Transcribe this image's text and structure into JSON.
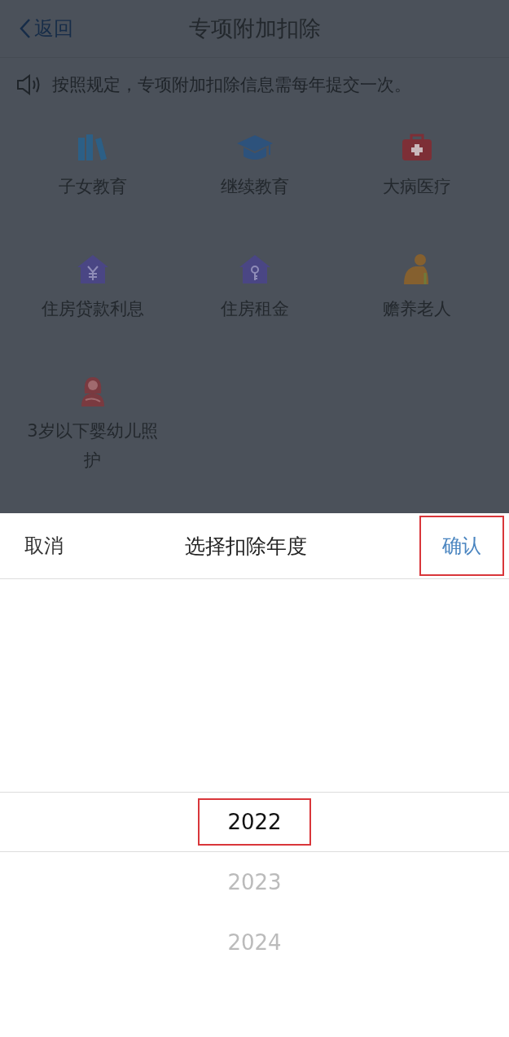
{
  "nav": {
    "back": "返回",
    "title": "专项附加扣除"
  },
  "notice": "按照规定，专项附加扣除信息需每年提交一次。",
  "categories": [
    {
      "kind": "books",
      "label": "子女教育"
    },
    {
      "kind": "cap",
      "label": "继续教育"
    },
    {
      "kind": "medkit",
      "label": "大病医疗"
    },
    {
      "kind": "house-yen",
      "label": "住房贷款利息"
    },
    {
      "kind": "house-key",
      "label": "住房租金"
    },
    {
      "kind": "elder",
      "label": "赡养老人"
    },
    {
      "kind": "mother",
      "label": "3岁以下婴幼儿照护"
    }
  ],
  "sheet": {
    "cancel": "取消",
    "title": "选择扣除年度",
    "confirm": {
      "label": "确认",
      "highlighted": true
    },
    "years": [
      {
        "label": "2022",
        "selected": true,
        "highlighted": true
      },
      {
        "label": "2023",
        "selected": false,
        "highlighted": false
      },
      {
        "label": "2024",
        "selected": false,
        "highlighted": false
      }
    ]
  }
}
